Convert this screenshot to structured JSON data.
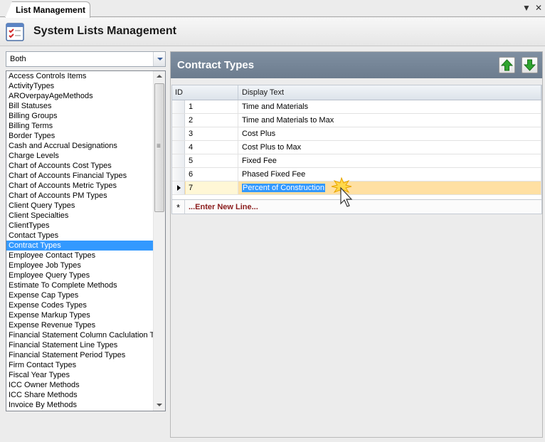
{
  "tab": {
    "label": "List Management"
  },
  "header": {
    "title": "System Lists Management"
  },
  "left_panel": {
    "filter": {
      "selected": "Both"
    },
    "items": [
      "Access Controls Items",
      "ActivityTypes",
      "AROverpayAgeMethods",
      "Bill Statuses",
      "Billing Groups",
      "Billing Terms",
      "Border Types",
      "Cash and Accrual Designations",
      "Charge Levels",
      "Chart of Accounts Cost Types",
      "Chart of Accounts Financial Types",
      "Chart of Accounts Metric Types",
      "Chart of Accounts PM Types",
      "Client Query Types",
      "Client Specialties",
      "ClientTypes",
      "Contact Types",
      "Contract Types",
      "Employee Contact Types",
      "Employee Job Types",
      "Employee Query Types",
      "Estimate To Complete Methods",
      "Expense Cap Types",
      "Expense Codes Types",
      "Expense Markup Types",
      "Expense Revenue Types",
      "Financial Statement Column Caclulation Ty",
      "Financial Statement Line Types",
      "Financial Statement Period Types",
      "Firm Contact Types",
      "Fiscal Year Types",
      "ICC Owner Methods",
      "ICC Share Methods",
      "Invoice By Methods"
    ],
    "selected_index": 17
  },
  "right_panel": {
    "title": "Contract Types",
    "grid": {
      "columns": [
        "ID",
        "Display Text"
      ],
      "rows": [
        {
          "id": "1",
          "text": "Time and Materials"
        },
        {
          "id": "2",
          "text": "Time and Materials to Max"
        },
        {
          "id": "3",
          "text": "Cost Plus"
        },
        {
          "id": "4",
          "text": "Cost Plus to Max"
        },
        {
          "id": "5",
          "text": "Fixed Fee"
        },
        {
          "id": "6",
          "text": "Phased Fixed Fee"
        },
        {
          "id": "7",
          "text": "Percent of Construction"
        }
      ],
      "active_row_index": 6,
      "new_line_label": "...Enter New Line...",
      "new_line_marker": "*"
    }
  },
  "colors": {
    "selection": "#3399ff",
    "active_row": "#ffe0a3",
    "panel_header": "#75869a",
    "new_line_text": "#8b1c1c",
    "arrow_green": "#2fa52f"
  }
}
